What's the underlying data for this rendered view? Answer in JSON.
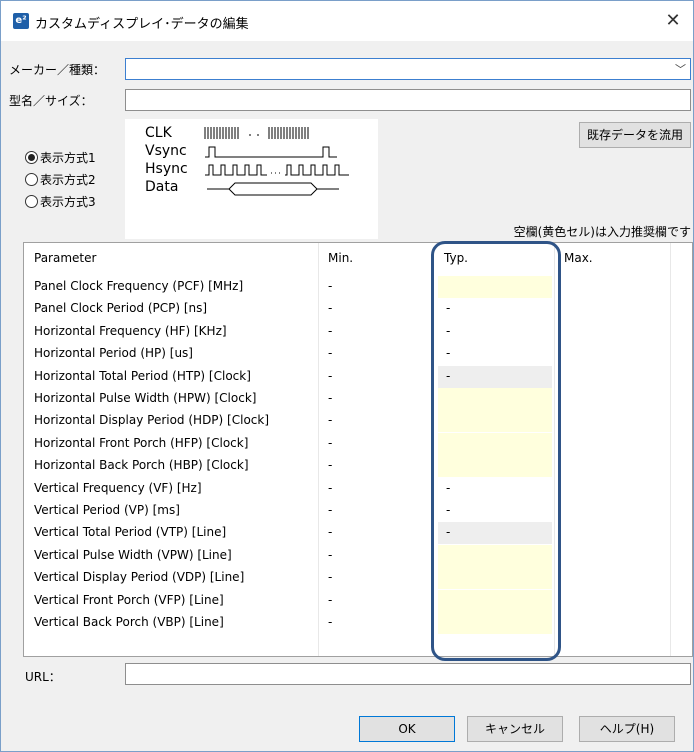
{
  "window": {
    "icon": "e²",
    "title": "カスタムディスプレイ･データの編集",
    "close": "✕"
  },
  "form": {
    "maker_label": "メーカー／種類：",
    "maker_value": "",
    "model_label": "型名／サイズ：",
    "model_value": "",
    "url_label": "URL："
  },
  "display_modes": [
    {
      "label": "表示方式1",
      "checked": true
    },
    {
      "label": "表示方式2",
      "checked": false
    },
    {
      "label": "表示方式3",
      "checked": false
    }
  ],
  "timing": {
    "signals": [
      "CLK",
      "Vsync",
      "Hsync",
      "Data"
    ]
  },
  "copy_button": "既存データを流用",
  "note": "空欄(黄色セル)は入力推奨欄です",
  "table": {
    "headers": [
      "Parameter",
      "Min.",
      "Typ.",
      "Max."
    ],
    "rows": [
      {
        "param": "Panel Clock Frequency (PCF) [MHz]",
        "min": "-",
        "typ": "",
        "state": "yellow"
      },
      {
        "param": "Panel Clock Period (PCP) [ns]",
        "min": "-",
        "typ": "-",
        "state": "plain"
      },
      {
        "param": "Horizontal Frequency (HF) [KHz]",
        "min": "-",
        "typ": "-",
        "state": "plain"
      },
      {
        "param": "Horizontal Period (HP) [us]",
        "min": "-",
        "typ": "-",
        "state": "plain"
      },
      {
        "param": "Horizontal Total Period (HTP) [Clock]",
        "min": "-",
        "typ": "-",
        "state": "gray"
      },
      {
        "param": "Horizontal Pulse Width (HPW) [Clock]",
        "min": "-",
        "typ": "",
        "state": "yellow"
      },
      {
        "param": "Horizontal Display Period (HDP) [Clock]",
        "min": "-",
        "typ": "",
        "state": "yellow"
      },
      {
        "param": "Horizontal Front Porch (HFP) [Clock]",
        "min": "-",
        "typ": "",
        "state": "yellow"
      },
      {
        "param": "Horizontal Back Porch (HBP) [Clock]",
        "min": "-",
        "typ": "",
        "state": "yellow"
      },
      {
        "param": "Vertical Frequency (VF) [Hz]",
        "min": "-",
        "typ": "-",
        "state": "plain"
      },
      {
        "param": "Vertical Period (VP) [ms]",
        "min": "-",
        "typ": "-",
        "state": "plain"
      },
      {
        "param": "Vertical Total Period (VTP) [Line]",
        "min": "-",
        "typ": "-",
        "state": "gray"
      },
      {
        "param": "Vertical Pulse Width (VPW) [Line]",
        "min": "-",
        "typ": "",
        "state": "yellow"
      },
      {
        "param": "Vertical Display Period (VDP) [Line]",
        "min": "-",
        "typ": "",
        "state": "yellow"
      },
      {
        "param": "Vertical Front Porch (VFP) [Line]",
        "min": "-",
        "typ": "",
        "state": "yellow"
      },
      {
        "param": "Vertical Back Porch (VBP) [Line]",
        "min": "-",
        "typ": "",
        "state": "yellow"
      }
    ]
  },
  "buttons": {
    "ok": "OK",
    "cancel": "キャンセル",
    "help": "ヘルプ(H)"
  },
  "colors": {
    "input_recommended": "#ffffdd",
    "computed": "#eeeeee",
    "highlight": "#2f5487"
  }
}
